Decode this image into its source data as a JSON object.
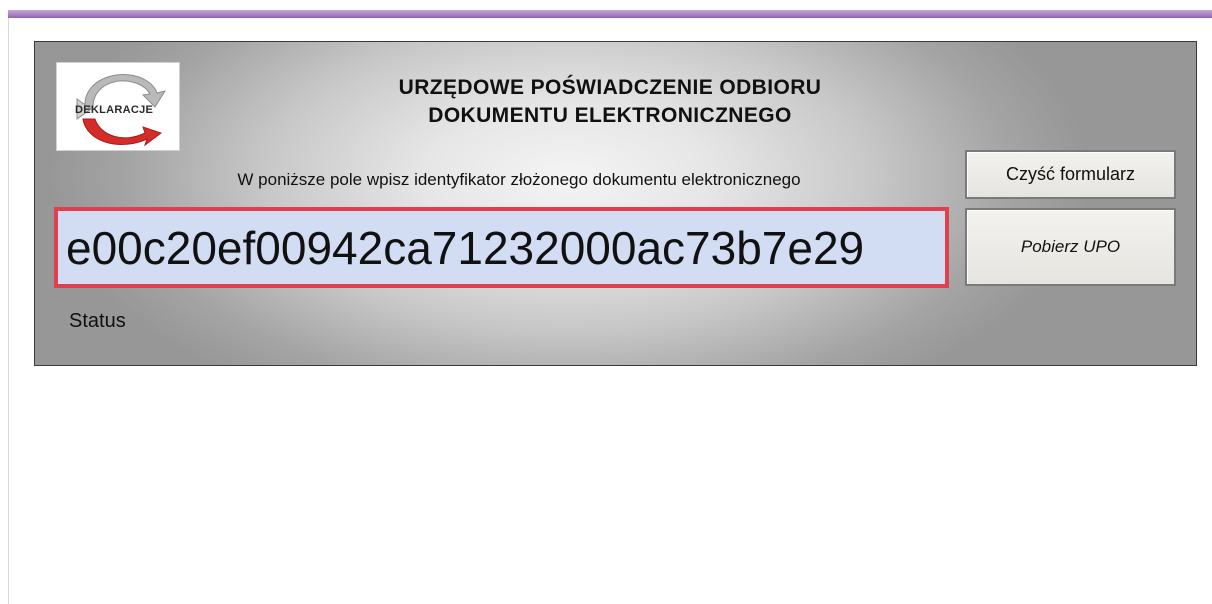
{
  "header": {
    "title_line1": "URZĘDOWE POŚWIADCZENIE ODBIORU",
    "title_line2": "DOKUMENTU ELEKTRONICZNEGO"
  },
  "logo": {
    "text": "DEKLARACJE",
    "icon": "e-deklaracje-logo-icon"
  },
  "form": {
    "instruction": "W poniższe pole wpisz identyfikator złożonego dokumentu elektronicznego",
    "document_id_value": "e00c20ef00942ca71232000ac73b7e29",
    "status_label": "Status"
  },
  "buttons": {
    "clear_label": "Czyść formularz",
    "get_upo_label": "Pobierz UPO"
  },
  "colors": {
    "field_border": "#e0404e",
    "field_background": "#d2dcf3",
    "top_stripe": "#a87fc0",
    "logo_red": "#d42b2b"
  }
}
